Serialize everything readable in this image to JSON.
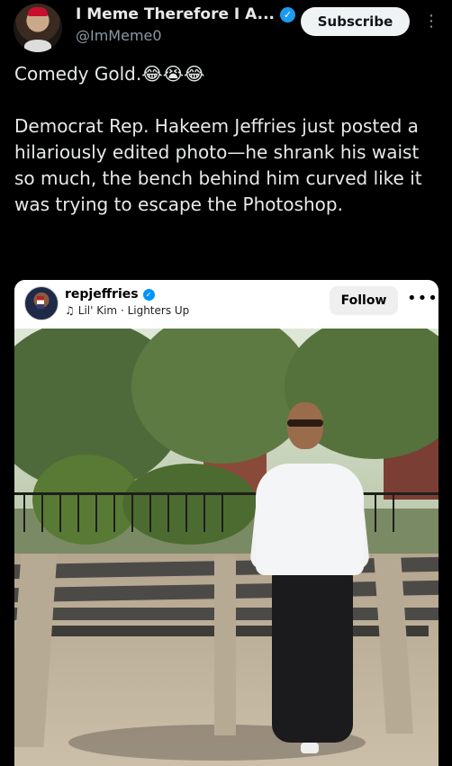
{
  "tweet": {
    "author": {
      "display_name": "I Meme Therefore I A...",
      "handle": "@ImMeme0",
      "verified_icon": "verified-badge-icon"
    },
    "subscribe_label": "Subscribe",
    "more_icon": "more-vertical-icon",
    "text_line1": "Comedy Gold.😂😭😂",
    "text_line2": "Democrat Rep. Hakeem Jeffries just posted a hilariously edited photo—he shrank his waist so much, the bench behind him curved like it was trying to escape the Photoshop."
  },
  "embed": {
    "username": "repjeffries",
    "verified_icon": "verified-badge-icon",
    "music_icon": "music-note-icon",
    "music": "Lil' Kim · Lighters Up",
    "follow_label": "Follow",
    "more_label": "•••"
  },
  "colors": {
    "background": "#000000",
    "text": "#e7e9ea",
    "secondary_text": "#8b98a5",
    "verified_blue": "#1d9bf0",
    "ig_verified_blue": "#0095f6"
  }
}
